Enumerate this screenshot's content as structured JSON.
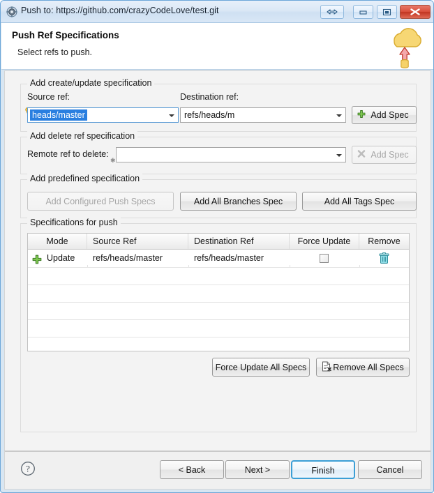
{
  "window": {
    "title": "Push to: https://github.com/crazyCodeLove/test.git",
    "icon": "app-gear-icon",
    "controls": {
      "resize": "resize-icon",
      "minimize": "minimize-icon",
      "maximize": "maximize-icon",
      "close": "close-icon"
    }
  },
  "header": {
    "title": "Push Ref Specifications",
    "subtitle": "Select refs to push.",
    "art": "cloud-push-icon"
  },
  "create_group": {
    "legend": "Add create/update specification",
    "source_label": "Source ref:",
    "source_value": "heads/master",
    "destination_label": "Destination ref:",
    "destination_value": "refs/heads/m",
    "add_spec_label": "Add Spec"
  },
  "delete_group": {
    "legend": "Add delete ref specification",
    "remote_label": "Remote ref to delete:",
    "remote_value": "",
    "add_spec_label": "Add Spec"
  },
  "predefined_group": {
    "legend": "Add predefined specification",
    "configured_label": "Add Configured Push Specs",
    "branches_label": "Add All Branches Spec",
    "tags_label": "Add All Tags Spec"
  },
  "specs_group": {
    "legend": "Specifications for push",
    "columns": [
      "Mode",
      "Source Ref",
      "Destination Ref",
      "Force Update",
      "Remove"
    ],
    "rows": [
      {
        "mode_icon": "plus-icon",
        "mode": "Update",
        "source_ref": "refs/heads/master",
        "destination_ref": "refs/heads/master",
        "force_update": false,
        "remove_icon": "trash-icon"
      }
    ],
    "force_update_all_label": "Force Update All Specs",
    "remove_all_label": "Remove All Specs"
  },
  "footer": {
    "help_icon": "help-icon",
    "back_label": "< Back",
    "next_label": "Next >",
    "finish_label": "Finish",
    "cancel_label": "Cancel"
  },
  "colors": {
    "accent": "#3c9fd6",
    "selection": "#2a7fe0",
    "close": "#d9503c",
    "plus": "#74bb44",
    "trash": "#3fa9b5"
  }
}
